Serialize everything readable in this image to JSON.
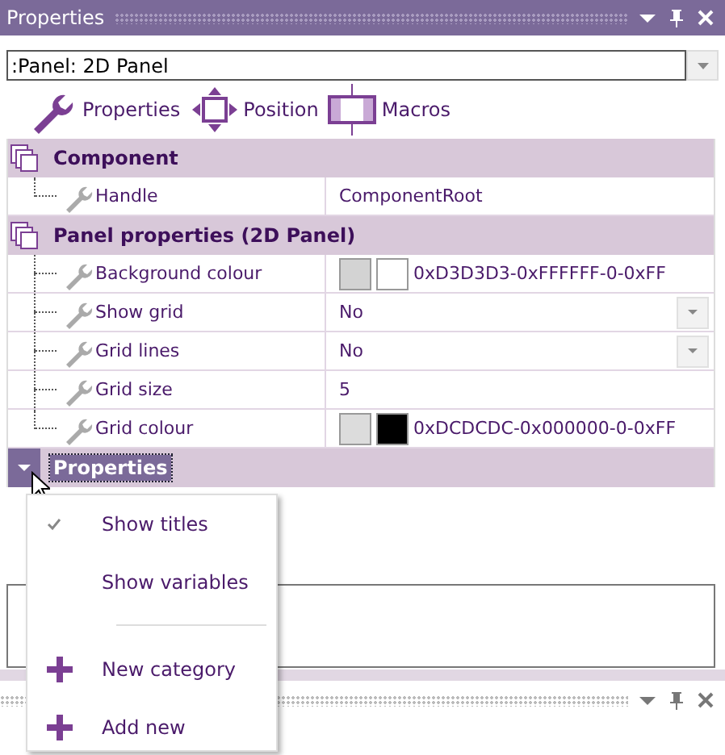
{
  "window": {
    "title": "Properties"
  },
  "selector": {
    "value": ":Panel: 2D Panel"
  },
  "toolbar": [
    {
      "label": "Properties",
      "kind": "wrench"
    },
    {
      "label": "Position",
      "kind": "move"
    },
    {
      "label": "Macros",
      "kind": "macro"
    }
  ],
  "grid": [
    {
      "category": "Component",
      "collapsed": false,
      "selected": false,
      "rows": [
        {
          "name": "Handle",
          "kind": "text",
          "value": "ComponentRoot"
        }
      ]
    },
    {
      "category": "Panel properties (2D Panel)",
      "collapsed": false,
      "selected": false,
      "rows": [
        {
          "name": "Background colour",
          "kind": "color",
          "value": "0xD3D3D3-0xFFFFFF-0-0xFF"
        },
        {
          "name": "Show grid",
          "kind": "dropdown",
          "value": "No"
        },
        {
          "name": "Grid lines",
          "kind": "dropdown",
          "value": "No"
        },
        {
          "name": "Grid size",
          "kind": "text",
          "value": "5"
        },
        {
          "name": "Grid colour",
          "kind": "color",
          "value": "0xDCDCDC-0x000000-0-0xFF"
        }
      ]
    },
    {
      "category": "Properties",
      "collapsed": true,
      "selected": true
    }
  ],
  "context_menu": [
    {
      "kind": "check",
      "label": "Show titles",
      "checked": true
    },
    {
      "kind": "check",
      "label": "Show variables",
      "checked": false
    },
    {
      "kind": "separator"
    },
    {
      "kind": "add",
      "label": "New category"
    },
    {
      "kind": "add",
      "label": "Add new"
    }
  ]
}
